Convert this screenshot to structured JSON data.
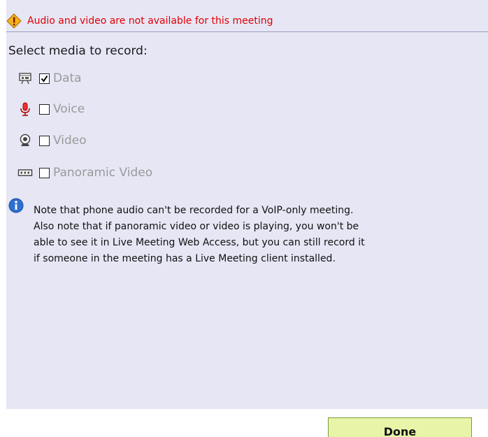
{
  "warning": {
    "icon": "warning-diamond-icon",
    "text": "Audio and video are not available for this meeting",
    "color": "#e00000"
  },
  "media_section": {
    "label": "Select media to record:",
    "items": [
      {
        "label": "Data",
        "icon": "data-presentation-icon",
        "checked": true
      },
      {
        "label": "Voice",
        "icon": "microphone-icon",
        "checked": false
      },
      {
        "label": "Video",
        "icon": "webcam-icon",
        "checked": false
      },
      {
        "label": "Panoramic Video",
        "icon": "panoramic-camera-icon",
        "checked": false
      }
    ]
  },
  "note": {
    "icon": "info-icon",
    "lines": [
      "Note that phone audio can't be recorded for a VoIP-only meeting.",
      "Also note that if panoramic video or video is playing, you won't be",
      "able to see it in Live Meeting Web Access, but you can still record it",
      "if someone in the meeting has a Live Meeting client installed."
    ]
  },
  "done_button": {
    "label": "Done"
  },
  "colors": {
    "panel": "#e6e6f5",
    "disabled_text": "#9a9a9a",
    "button_fill": "#e8f5a8",
    "button_border": "#7b9a3c"
  }
}
